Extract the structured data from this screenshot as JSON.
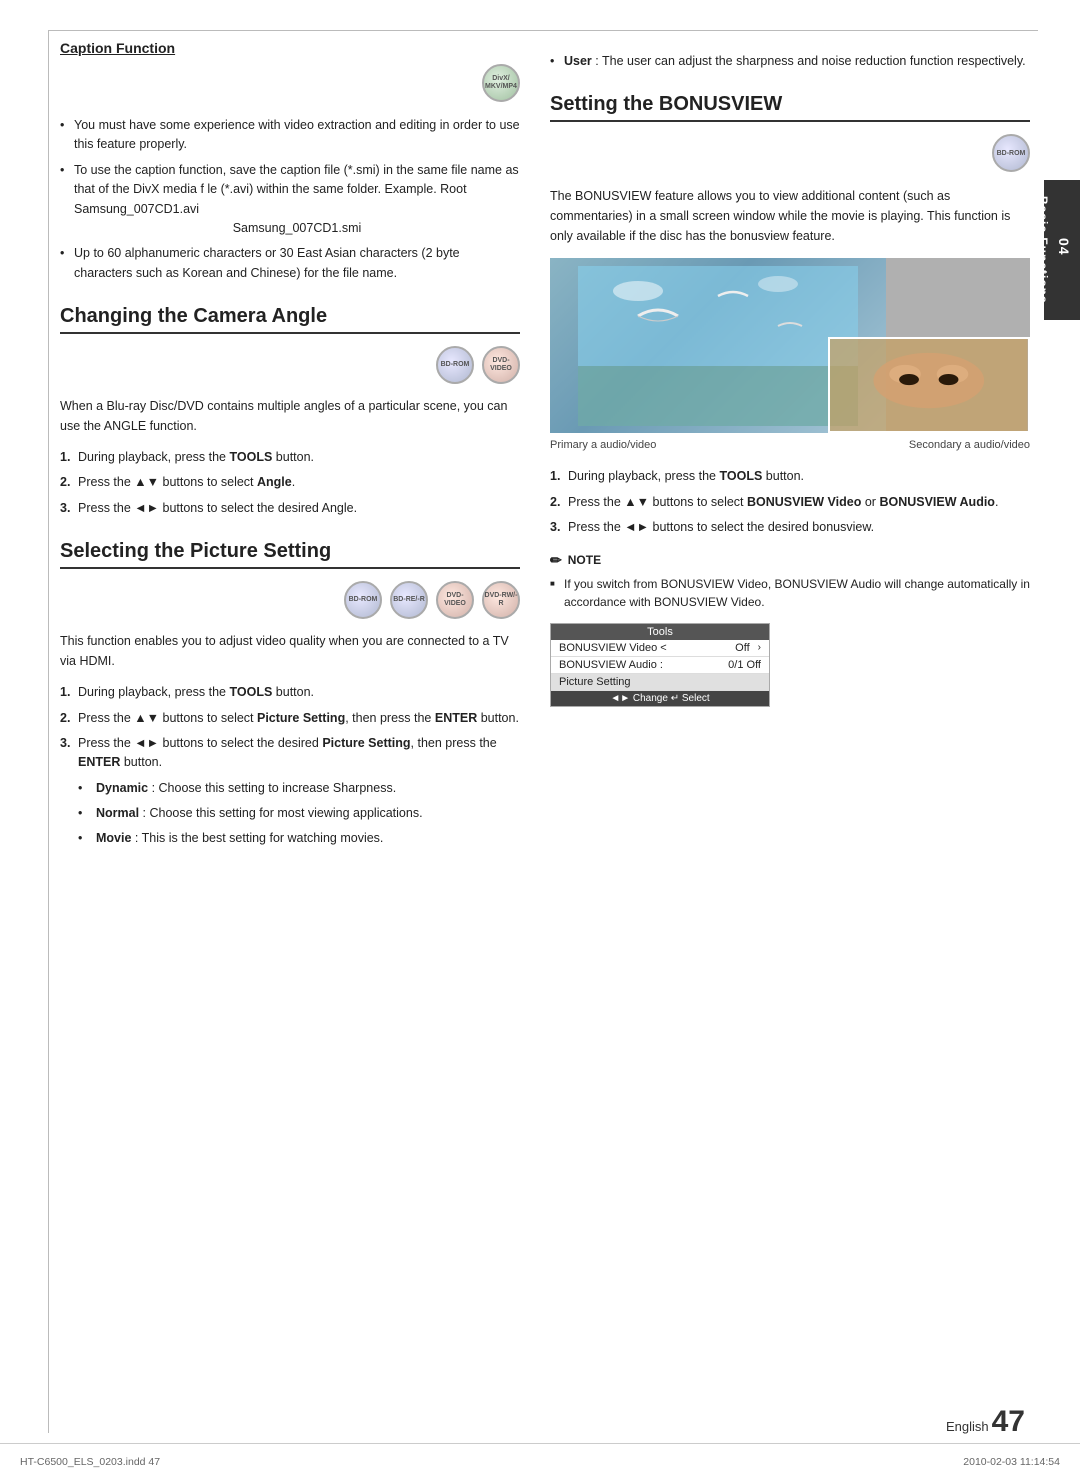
{
  "page": {
    "number": "47",
    "english_label": "English",
    "chapter_number": "04",
    "chapter_title": "Basic Functions",
    "bottom_left": "HT-C6500_ELS_0203.indd  47",
    "bottom_right": "2010-02-03     11:14:54"
  },
  "left_column": {
    "caption_section": {
      "title": "Caption Function",
      "disc_icon": {
        "label": "DivX/MKV/MP4",
        "type": "divx"
      },
      "bullets": [
        "You must have some experience with video extraction and editing in order to use this feature properly.",
        "To use the caption function, save the caption file (*.smi) in the same file name as that of the DivX media f le (*.avi) within the same folder. Example. Root Samsung_007CD1.avi",
        "Up to 60 alphanumeric characters or 30 East Asian characters (2 byte characters such as Korean and Chinese) for the file name."
      ],
      "center_text": "Samsung_007CD1.smi"
    },
    "camera_section": {
      "title": "Changing the Camera Angle",
      "disc_icons": [
        {
          "label": "BD-ROM",
          "type": "bd"
        },
        {
          "label": "DVD-VIDEO",
          "type": "dvd"
        }
      ],
      "intro": "When a Blu-ray Disc/DVD contains multiple angles of a particular scene, you can use the ANGLE function.",
      "steps": [
        {
          "num": "1.",
          "text": "During playback, press the ",
          "bold": "TOOLS",
          "rest": " button."
        },
        {
          "num": "2.",
          "text": "Press the ▲▼ buttons to select ",
          "bold": "Angle",
          "rest": "."
        },
        {
          "num": "3.",
          "text": "Press the ◄► buttons to select the desired Angle.",
          "bold": "",
          "rest": ""
        }
      ]
    },
    "picture_section": {
      "title": "Selecting the Picture Setting",
      "disc_icons": [
        {
          "label": "BD-ROM",
          "type": "bd"
        },
        {
          "label": "BD-RE/-R",
          "type": "bd"
        },
        {
          "label": "DVD-VIDEO",
          "type": "dvd"
        },
        {
          "label": "DVD-RW/-R",
          "type": "dvd"
        }
      ],
      "intro": "This function enables you to adjust video quality when you are connected to a TV via HDMI.",
      "steps": [
        {
          "num": "1.",
          "text": "During playback, press the ",
          "bold": "TOOLS",
          "rest": " button."
        },
        {
          "num": "2.",
          "text": "Press the ▲▼ buttons to select ",
          "bold": "Picture Setting",
          "rest": ", then press the ",
          "bold2": "ENTER",
          "rest2": " button."
        },
        {
          "num": "3.",
          "text": "Press the ◄► buttons to select the desired ",
          "bold": "Picture Setting",
          "rest": ", then press the ",
          "bold2": "ENTER",
          "rest2": " button."
        }
      ],
      "sub_bullets": [
        {
          "bold": "Dynamic",
          "rest": " : Choose this setting to increase Sharpness."
        },
        {
          "bold": "Normal",
          "rest": " : Choose this setting for most viewing applications."
        },
        {
          "bold": "Movie",
          "rest": " : This is the best setting for watching movies."
        }
      ],
      "user_bullet": {
        "bold": "User",
        "rest": " : The user can adjust the sharpness and noise reduction function respectively."
      }
    }
  },
  "right_column": {
    "user_bullet": "User : The user can adjust the sharpness and noise reduction function respectively.",
    "bonusview_section": {
      "title": "Setting the BONUSVIEW",
      "disc_icon": {
        "label": "BD-ROM",
        "type": "bd"
      },
      "intro": "The BONUSVIEW feature allows you to view additional content (such as commentaries) in a small screen window while the movie is playing. This function is only available if the disc has the bonusview feature.",
      "image_label_primary": "Primary a audio/video",
      "image_label_secondary": "Secondary a audio/video",
      "steps": [
        {
          "num": "1.",
          "text": "During playback, press the ",
          "bold": "TOOLS",
          "rest": " button."
        },
        {
          "num": "2.",
          "text": "Press the ▲▼ buttons to select ",
          "bold": "BONUSVIEW Video",
          "rest": " or ",
          "bold2": "BONUSVIEW Audio",
          "rest2": "."
        },
        {
          "num": "3.",
          "text": "Press the ◄► buttons to select the desired bonusview.",
          "bold": "",
          "rest": ""
        }
      ],
      "note": {
        "header": "NOTE",
        "items": [
          "If you switch from BONUSVIEW Video, BONUSVIEW Audio will change automatically in accordance with BONUSVIEW Video."
        ]
      },
      "tools_table": {
        "header": "Tools",
        "rows": [
          {
            "label": "BONUSVIEW Video <",
            "value": "Off",
            "has_chevron": true
          },
          {
            "label": "BONUSVIEW Audio :",
            "value": "0/1 Off",
            "has_chevron": false
          },
          {
            "label": "Picture Setting",
            "value": "",
            "has_chevron": false
          }
        ],
        "footer": "◄► Change   ↵ Select"
      }
    }
  }
}
